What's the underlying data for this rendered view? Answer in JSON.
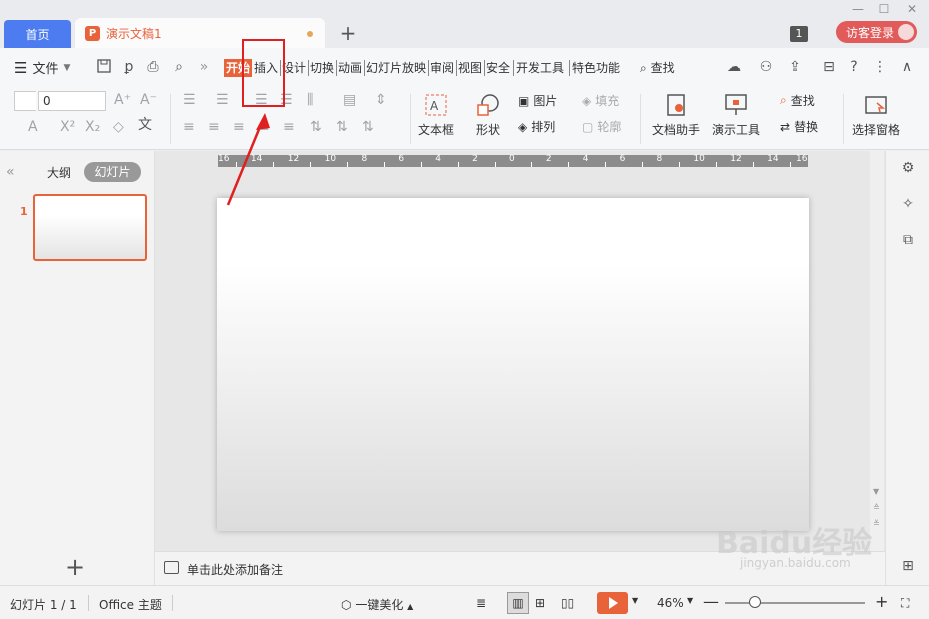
{
  "tabs": {
    "home": "首页",
    "doc": "演示文稿1",
    "badge": "1",
    "login": "访客登录"
  },
  "menu": {
    "file": "文件",
    "more": "»",
    "items": [
      "开始",
      "插入",
      "设计",
      "切换",
      "动画",
      "幻灯片放映",
      "审阅",
      "视图",
      "安全",
      "开发工具",
      "特色功能"
    ],
    "search": "查找"
  },
  "ribbon": {
    "font_size": "0",
    "text_box": "文本框",
    "shape": "形状",
    "picture": "图片",
    "fill": "填充",
    "arrange": "排列",
    "outline": "轮廓",
    "doc_helper": "文档助手",
    "present_tools": "演示工具",
    "find": "查找",
    "replace": "替换",
    "select_pane": "选择窗格"
  },
  "left_panel": {
    "outline_tab": "大纲",
    "slides_tab": "幻灯片",
    "thumb_number": "1"
  },
  "notes": {
    "placeholder": "单击此处添加备注"
  },
  "status": {
    "slide_count": "幻灯片 1 / 1",
    "theme": "Office 主题",
    "beautify": "一键美化",
    "zoom": "46%"
  },
  "ruler_labels": [
    "16",
    "14",
    "12",
    "10",
    "8",
    "6",
    "4",
    "2",
    "0",
    "2",
    "4",
    "6",
    "8",
    "10",
    "12",
    "14",
    "16"
  ],
  "watermark": {
    "main": "Baidu经验",
    "sub": "jingyan.baidu.com"
  },
  "colors": {
    "accent": "#e8623a",
    "home_tab": "#4d7cf0",
    "annotation": "#e02020"
  }
}
